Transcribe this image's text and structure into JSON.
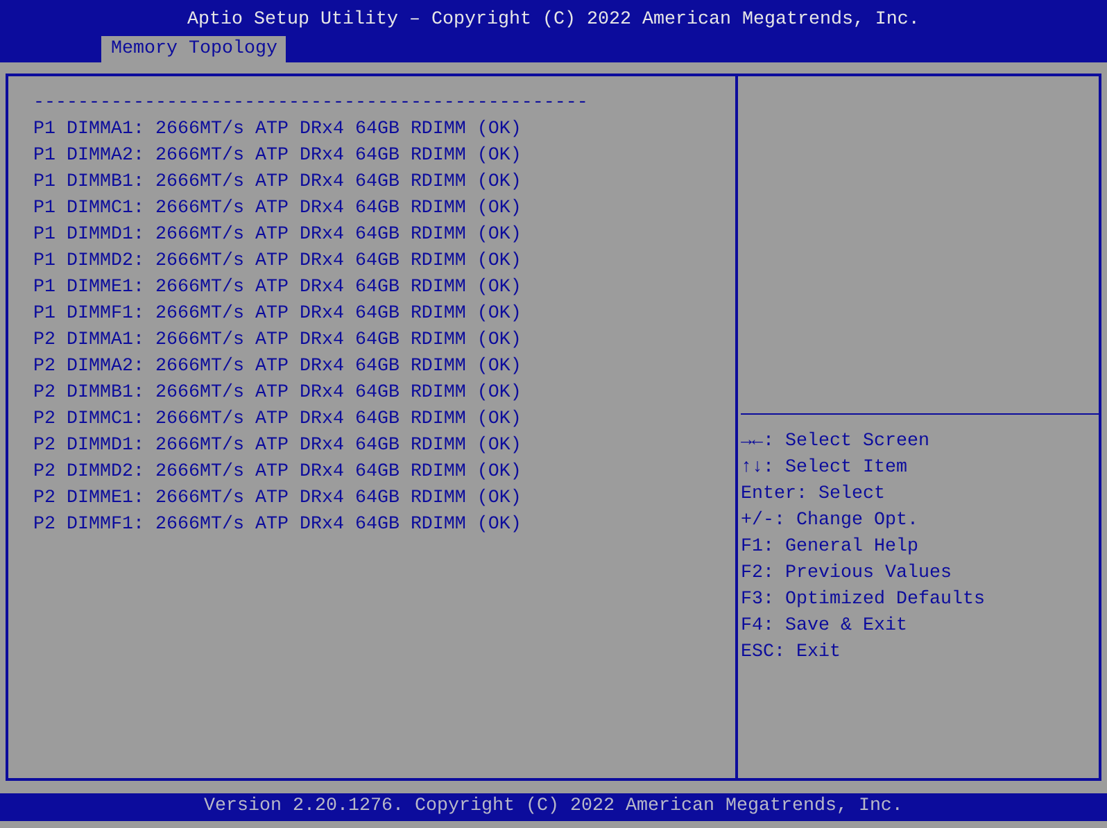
{
  "header": {
    "title": "Aptio Setup Utility – Copyright (C) 2022 American Megatrends, Inc.",
    "tabs": [
      {
        "label": "Memory Topology",
        "selected": true
      }
    ]
  },
  "left_panel": {
    "separator": "--------------------------------------------------",
    "rows": [
      "P1 DIMMA1: 2666MT/s ATP DRx4 64GB RDIMM (OK)",
      "P1 DIMMA2: 2666MT/s ATP DRx4 64GB RDIMM (OK)",
      "P1 DIMMB1: 2666MT/s ATP DRx4 64GB RDIMM (OK)",
      "P1 DIMMC1: 2666MT/s ATP DRx4 64GB RDIMM (OK)",
      "P1 DIMMD1: 2666MT/s ATP DRx4 64GB RDIMM (OK)",
      "P1 DIMMD2: 2666MT/s ATP DRx4 64GB RDIMM (OK)",
      "P1 DIMME1: 2666MT/s ATP DRx4 64GB RDIMM (OK)",
      "P1 DIMMF1: 2666MT/s ATP DRx4 64GB RDIMM (OK)",
      "P2 DIMMA1: 2666MT/s ATP DRx4 64GB RDIMM (OK)",
      "P2 DIMMA2: 2666MT/s ATP DRx4 64GB RDIMM (OK)",
      "P2 DIMMB1: 2666MT/s ATP DRx4 64GB RDIMM (OK)",
      "P2 DIMMC1: 2666MT/s ATP DRx4 64GB RDIMM (OK)",
      "P2 DIMMD1: 2666MT/s ATP DRx4 64GB RDIMM (OK)",
      "P2 DIMMD2: 2666MT/s ATP DRx4 64GB RDIMM (OK)",
      "P2 DIMME1: 2666MT/s ATP DRx4 64GB RDIMM (OK)",
      "P2 DIMMF1: 2666MT/s ATP DRx4 64GB RDIMM (OK)"
    ]
  },
  "help_panel": {
    "keys": [
      "→←: Select Screen",
      "↑↓: Select Item",
      "Enter: Select",
      "+/-: Change Opt.",
      "F1: General Help",
      "F2: Previous Values",
      "F3: Optimized Defaults",
      "F4: Save & Exit",
      "ESC: Exit"
    ]
  },
  "status_bar": {
    "text": "Version 2.20.1276. Copyright (C) 2022 American Megatrends, Inc."
  }
}
